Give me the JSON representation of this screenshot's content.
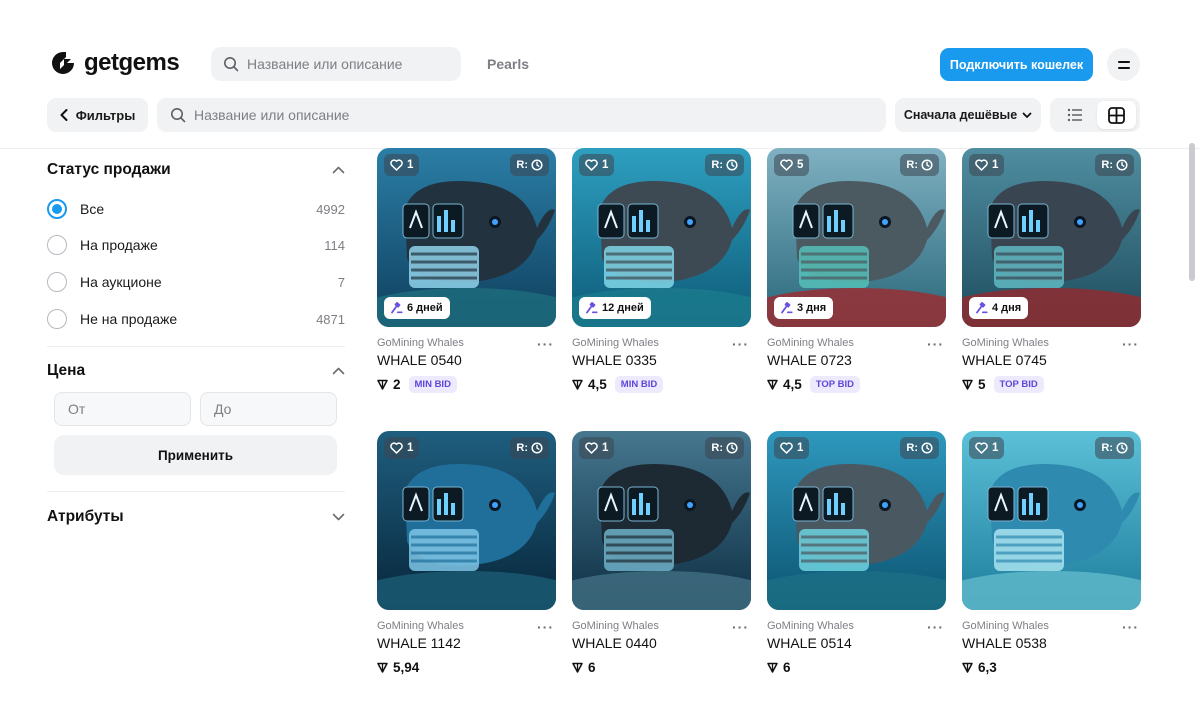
{
  "header": {
    "logo_text": "getgems",
    "search_placeholder": "Название или описание",
    "nav_link": "Pearls",
    "connect_label": "Подключить кошелек"
  },
  "toolbar": {
    "filters_label": "Фильтры",
    "search_placeholder": "Название или описание",
    "sort_label": "Сначала дешёвые"
  },
  "sidebar": {
    "status_title": "Статус продажи",
    "status_options": [
      {
        "label": "Все",
        "count": "4992",
        "checked": true
      },
      {
        "label": "На продаже",
        "count": "114",
        "checked": false
      },
      {
        "label": "На аукционе",
        "count": "7",
        "checked": false
      },
      {
        "label": "Не на продаже",
        "count": "4871",
        "checked": false
      }
    ],
    "price_title": "Цена",
    "price_from_placeholder": "От",
    "price_to_placeholder": "До",
    "apply_label": "Применить",
    "attributes_title": "Атрибуты"
  },
  "cards": [
    {
      "collection": "GoMining Whales",
      "name": "WHALE 0540",
      "likes": "1",
      "r_label": "R:",
      "time_left": "6 дней",
      "price": "2",
      "bid_tag": "MIN BID"
    },
    {
      "collection": "GoMining Whales",
      "name": "WHALE 0335",
      "likes": "1",
      "r_label": "R:",
      "time_left": "12 дней",
      "price": "4,5",
      "bid_tag": "MIN BID"
    },
    {
      "collection": "GoMining Whales",
      "name": "WHALE 0723",
      "likes": "5",
      "r_label": "R:",
      "time_left": "3 дня",
      "price": "4,5",
      "bid_tag": "TOP BID"
    },
    {
      "collection": "GoMining Whales",
      "name": "WHALE 0745",
      "likes": "1",
      "r_label": "R:",
      "time_left": "4 дня",
      "price": "5",
      "bid_tag": "TOP BID"
    },
    {
      "collection": "GoMining Whales",
      "name": "WHALE 1142",
      "likes": "1",
      "r_label": "R:",
      "time_left": "",
      "price": "5,94",
      "bid_tag": ""
    },
    {
      "collection": "GoMining Whales",
      "name": "WHALE 0440",
      "likes": "1",
      "r_label": "R:",
      "time_left": "",
      "price": "6",
      "bid_tag": ""
    },
    {
      "collection": "GoMining Whales",
      "name": "WHALE 0514",
      "likes": "1",
      "r_label": "R:",
      "time_left": "",
      "price": "6",
      "bid_tag": ""
    },
    {
      "collection": "GoMining Whales",
      "name": "WHALE 0538",
      "likes": "1",
      "r_label": "R:",
      "time_left": "",
      "price": "6,3",
      "bid_tag": ""
    }
  ],
  "icons": {
    "logo": "getgems-logo-icon",
    "search": "search-icon",
    "back": "chevron-left-icon",
    "sort": "chevron-down-icon",
    "list_view": "list-view-icon",
    "grid_view": "grid-view-icon",
    "like": "heart-icon",
    "clock": "clock-icon",
    "auction": "gavel-icon",
    "currency": "ton-icon",
    "more": "more-icon"
  },
  "colors": {
    "accent": "#1a9aef",
    "bid_tag_text": "#5b48d8",
    "bid_tag_bg": "#eeeafd"
  }
}
